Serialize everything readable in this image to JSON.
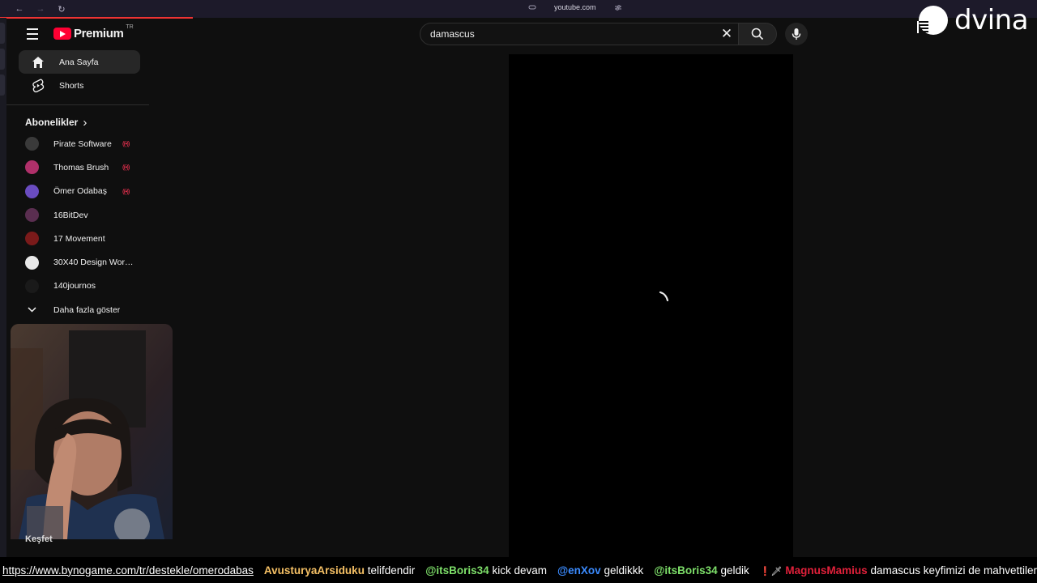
{
  "browser": {
    "back": "←",
    "forward": "→",
    "reload": "↻",
    "url": "youtube.com"
  },
  "header": {
    "brand": "Premium",
    "region": "TR",
    "search_query": "damascus",
    "clear": "✕"
  },
  "watermark": {
    "text": "dvina"
  },
  "sidebar": {
    "items": [
      {
        "label": "Ana Sayfa",
        "icon": "home-icon",
        "active": true
      },
      {
        "label": "Shorts",
        "icon": "shorts-icon",
        "active": false
      }
    ],
    "subscriptions_title": "Abonelikler",
    "subscriptions_chevron": "›",
    "subscriptions": [
      {
        "name": "Pirate Software",
        "live": true,
        "color": "#3a3a3a"
      },
      {
        "name": "Thomas Brush",
        "live": true,
        "color": "#b0306a"
      },
      {
        "name": "Ömer Odabaş",
        "live": true,
        "color": "#6a4cc0"
      },
      {
        "name": "16BitDev",
        "live": false,
        "color": "#5a2e50"
      },
      {
        "name": "17 Movement",
        "live": false,
        "color": "#7a1a1a"
      },
      {
        "name": "30X40 Design Work...",
        "live": false,
        "color": "#e8e8e8"
      },
      {
        "name": "140journos",
        "live": false,
        "color": "#1a1a1a"
      }
    ],
    "live_indicator": "((•))",
    "show_more": "Daha fazla göster",
    "explore": "Keşfet"
  },
  "ticker": {
    "link": "https://www.bynogame.com/tr/destekle/omerodabas",
    "messages": [
      {
        "user": "AvusturyaArsiduku",
        "text": "telifdendir",
        "color": "#f5c065"
      },
      {
        "user": "@itsBoris34",
        "text": "kick devam",
        "color": "#7ee06a"
      },
      {
        "user": "@enXov",
        "text": "geldikkk",
        "color": "#3b8bff"
      },
      {
        "user": "@itsBoris34",
        "text": "geldik",
        "color": "#7ee06a"
      },
      {
        "user": "MagnusMamius",
        "text": "damascus keyfimizi de mahvettiler",
        "color": "#e0203a",
        "badges": "❗🗡"
      }
    ]
  },
  "colors": {
    "accent": "#ff0033",
    "background": "#0f0f0f"
  }
}
